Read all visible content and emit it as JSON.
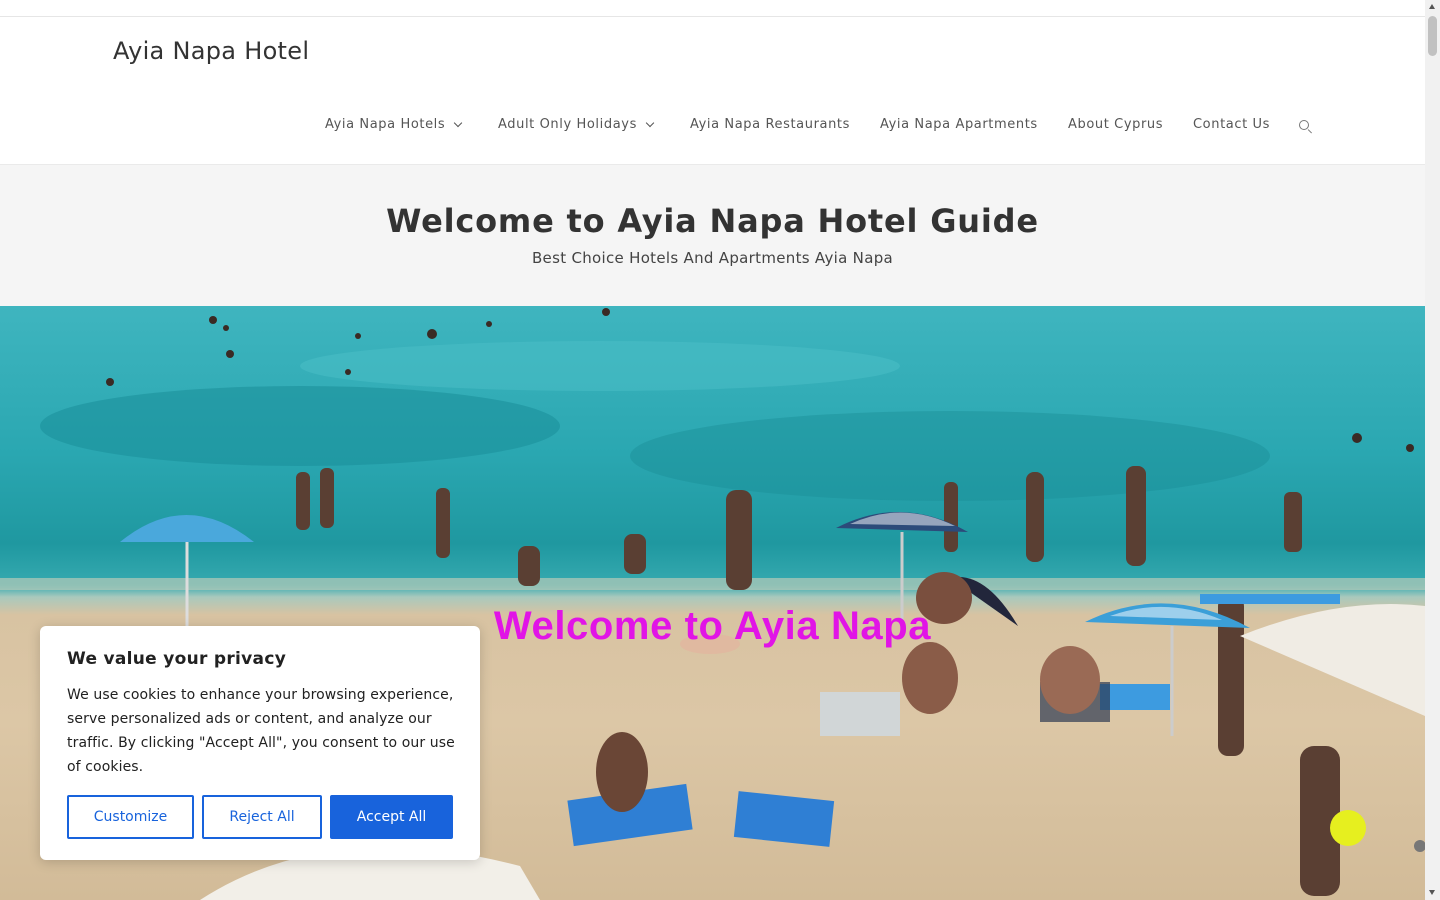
{
  "site": {
    "title": "Ayia Napa Hotel"
  },
  "nav": {
    "items": [
      {
        "label": "Ayia Napa Hotels",
        "has_dropdown": true
      },
      {
        "label": "Adult Only Holidays",
        "has_dropdown": true
      },
      {
        "label": "Ayia Napa Restaurants",
        "has_dropdown": false
      },
      {
        "label": "Ayia Napa Apartments",
        "has_dropdown": false
      },
      {
        "label": "About Cyprus",
        "has_dropdown": false
      },
      {
        "label": "Contact Us",
        "has_dropdown": false
      }
    ],
    "search_icon": "search-icon"
  },
  "hero": {
    "title": "Welcome to Ayia Napa Hotel Guide",
    "subtitle": "Best Choice Hotels And Apartments Ayia Napa"
  },
  "banner": {
    "caption": "Welcome to Ayia Napa",
    "caption_color": "#e114e6"
  },
  "cookie": {
    "heading": "We value your privacy",
    "body": "We use cookies to enhance your browsing experience, serve personalized ads or content, and analyze our traffic. By clicking \"Accept All\", you consent to our use of cookies.",
    "customize_label": "Customize",
    "reject_label": "Reject All",
    "accept_label": "Accept All",
    "accent_color": "#1863dc"
  }
}
